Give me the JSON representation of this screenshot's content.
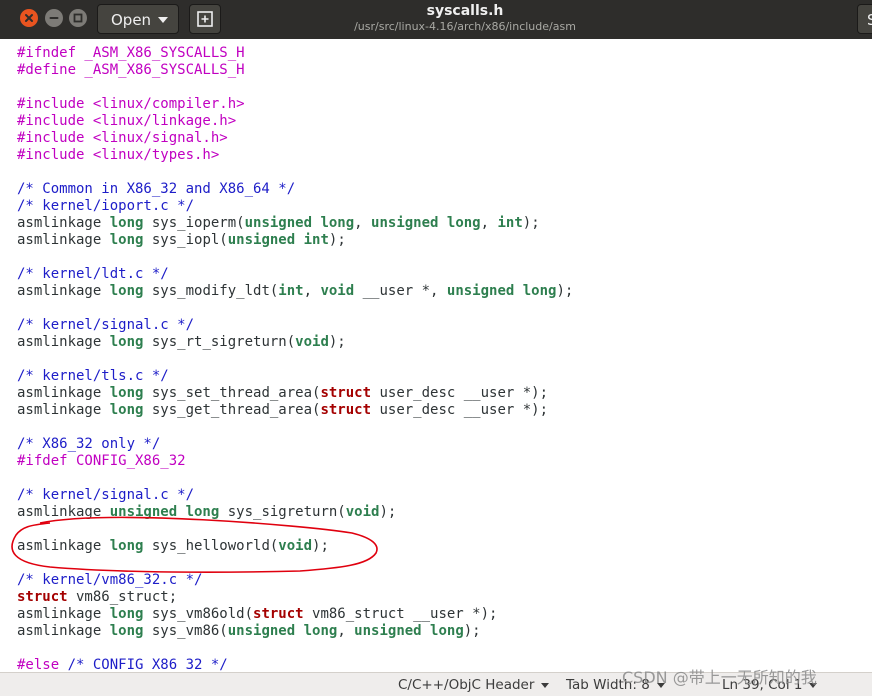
{
  "window": {
    "title": "syscalls.h",
    "path": "/usr/src/linux-4.16/arch/x86/include/asm",
    "open_label": "Open",
    "save_label_partial": "S"
  },
  "colors": {
    "titlebar": "#2e2d2b",
    "close_button": "#e95420",
    "preprocessor": "#c100c1",
    "comment": "#1d1dc8",
    "type": "#2e7f4f",
    "keyword": "#a40000",
    "annotation_circle": "#e0000e"
  },
  "code": {
    "lines": [
      [
        {
          "t": "#ifndef _ASM_X86_SYSCALLS_H",
          "c": "pp"
        }
      ],
      [
        {
          "t": "#define _ASM_X86_SYSCALLS_H",
          "c": "pp"
        }
      ],
      [],
      [
        {
          "t": "#include <linux/compiler.h>",
          "c": "pp"
        }
      ],
      [
        {
          "t": "#include <linux/linkage.h>",
          "c": "pp"
        }
      ],
      [
        {
          "t": "#include <linux/signal.h>",
          "c": "pp"
        }
      ],
      [
        {
          "t": "#include <linux/types.h>",
          "c": "pp"
        }
      ],
      [],
      [
        {
          "t": "/* Common in X86_32 and X86_64 */",
          "c": "cm"
        }
      ],
      [
        {
          "t": "/* kernel/ioport.c */",
          "c": "cm"
        }
      ],
      [
        {
          "t": "asmlinkage "
        },
        {
          "t": "long",
          "c": "ty"
        },
        {
          "t": " sys_ioperm("
        },
        {
          "t": "unsigned long",
          "c": "ty"
        },
        {
          "t": ", "
        },
        {
          "t": "unsigned long",
          "c": "ty"
        },
        {
          "t": ", "
        },
        {
          "t": "int",
          "c": "ty"
        },
        {
          "t": ");"
        }
      ],
      [
        {
          "t": "asmlinkage "
        },
        {
          "t": "long",
          "c": "ty"
        },
        {
          "t": " sys_iopl("
        },
        {
          "t": "unsigned int",
          "c": "ty"
        },
        {
          "t": ");"
        }
      ],
      [],
      [
        {
          "t": "/* kernel/ldt.c */",
          "c": "cm"
        }
      ],
      [
        {
          "t": "asmlinkage "
        },
        {
          "t": "long",
          "c": "ty"
        },
        {
          "t": " sys_modify_ldt("
        },
        {
          "t": "int",
          "c": "ty"
        },
        {
          "t": ", "
        },
        {
          "t": "void",
          "c": "ty"
        },
        {
          "t": " __user *, "
        },
        {
          "t": "unsigned long",
          "c": "ty"
        },
        {
          "t": ");"
        }
      ],
      [],
      [
        {
          "t": "/* kernel/signal.c */",
          "c": "cm"
        }
      ],
      [
        {
          "t": "asmlinkage "
        },
        {
          "t": "long",
          "c": "ty"
        },
        {
          "t": " sys_rt_sigreturn("
        },
        {
          "t": "void",
          "c": "ty"
        },
        {
          "t": ");"
        }
      ],
      [],
      [
        {
          "t": "/* kernel/tls.c */",
          "c": "cm"
        }
      ],
      [
        {
          "t": "asmlinkage "
        },
        {
          "t": "long",
          "c": "ty"
        },
        {
          "t": " sys_set_thread_area("
        },
        {
          "t": "struct",
          "c": "kw"
        },
        {
          "t": " user_desc __user *);"
        }
      ],
      [
        {
          "t": "asmlinkage "
        },
        {
          "t": "long",
          "c": "ty"
        },
        {
          "t": " sys_get_thread_area("
        },
        {
          "t": "struct",
          "c": "kw"
        },
        {
          "t": " user_desc __user *);"
        }
      ],
      [],
      [
        {
          "t": "/* X86_32 only */",
          "c": "cm"
        }
      ],
      [
        {
          "t": "#ifdef CONFIG_X86_32",
          "c": "pp"
        }
      ],
      [],
      [
        {
          "t": "/* kernel/signal.c */",
          "c": "cm"
        }
      ],
      [
        {
          "t": "asmlinkage "
        },
        {
          "t": "unsigned long",
          "c": "ty"
        },
        {
          "t": " sys_sigreturn("
        },
        {
          "t": "void",
          "c": "ty"
        },
        {
          "t": ");"
        }
      ],
      [],
      [
        {
          "t": "asmlinkage "
        },
        {
          "t": "long",
          "c": "ty"
        },
        {
          "t": " sys_helloworld("
        },
        {
          "t": "void",
          "c": "ty"
        },
        {
          "t": ");"
        }
      ],
      [],
      [
        {
          "t": "/* kernel/vm86_32.c */",
          "c": "cm"
        }
      ],
      [
        {
          "t": "struct",
          "c": "kw"
        },
        {
          "t": " vm86_struct;"
        }
      ],
      [
        {
          "t": "asmlinkage "
        },
        {
          "t": "long",
          "c": "ty"
        },
        {
          "t": " sys_vm86old("
        },
        {
          "t": "struct",
          "c": "kw"
        },
        {
          "t": " vm86_struct __user *);"
        }
      ],
      [
        {
          "t": "asmlinkage "
        },
        {
          "t": "long",
          "c": "ty"
        },
        {
          "t": " sys_vm86("
        },
        {
          "t": "unsigned long",
          "c": "ty"
        },
        {
          "t": ", "
        },
        {
          "t": "unsigned long",
          "c": "ty"
        },
        {
          "t": ");"
        }
      ],
      [],
      [
        {
          "t": "#else",
          "c": "pp"
        },
        {
          "t": " /* CONFIG_X86_32 */",
          "c": "cm"
        }
      ]
    ]
  },
  "statusbar": {
    "language": "C/C++/ObjC Header",
    "tab_width": "Tab Width: 8",
    "position": "Ln 39, Col 1"
  },
  "watermark": "CSDN @带上一无所知的我"
}
